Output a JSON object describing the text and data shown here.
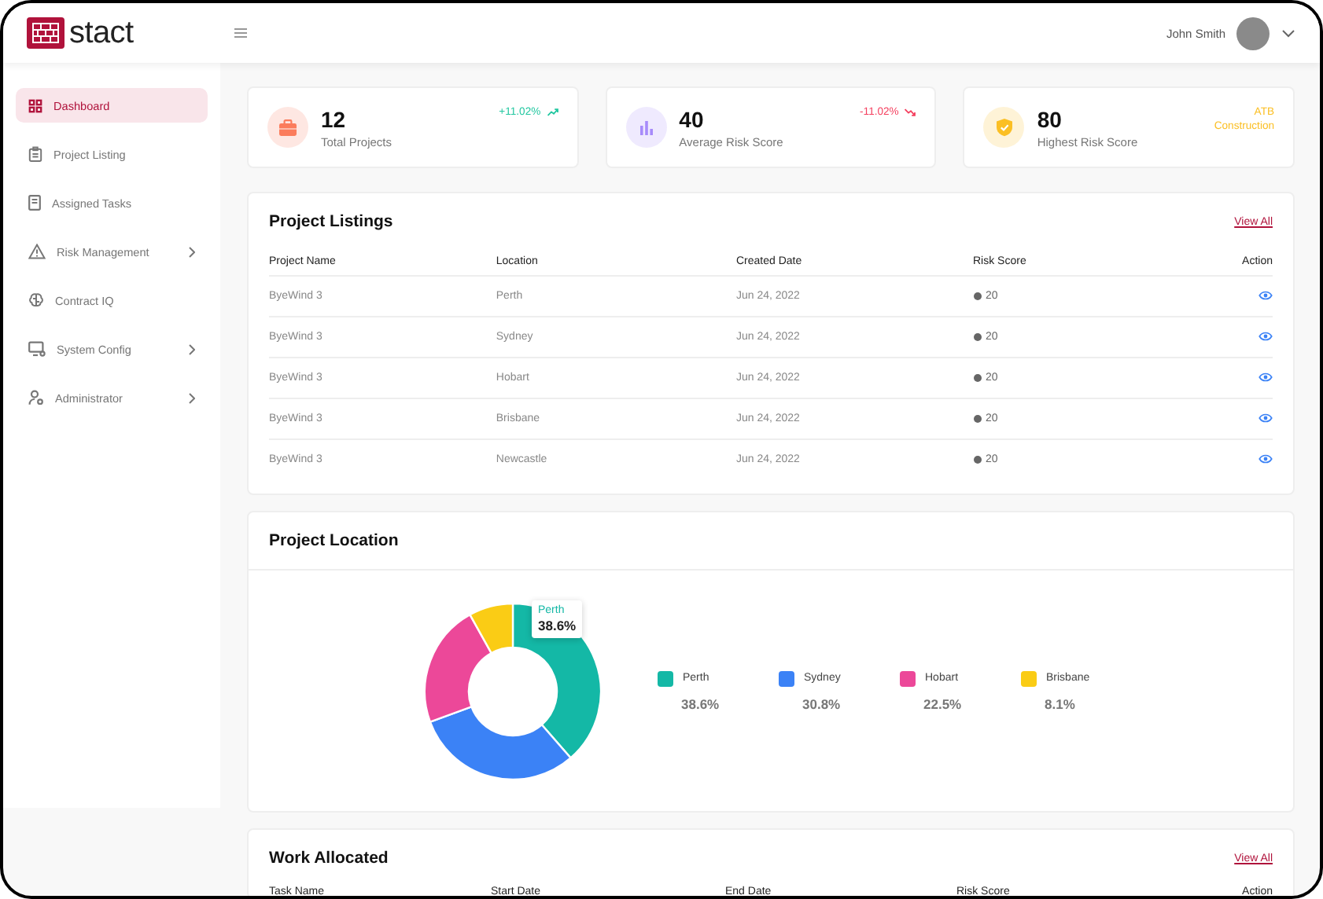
{
  "header": {
    "brand": "stact",
    "user_name": "John Smith"
  },
  "sidebar": {
    "items": [
      {
        "label": "Dashboard",
        "selected": true,
        "expandable": false
      },
      {
        "label": "Project Listing",
        "selected": false,
        "expandable": false
      },
      {
        "label": "Assigned Tasks",
        "selected": false,
        "expandable": false
      },
      {
        "label": "Risk Management",
        "selected": false,
        "expandable": true
      },
      {
        "label": "Contract IQ",
        "selected": false,
        "expandable": false
      },
      {
        "label": "System Config",
        "selected": false,
        "expandable": true
      },
      {
        "label": "Administrator",
        "selected": false,
        "expandable": true
      }
    ]
  },
  "stats": [
    {
      "value": "12",
      "label": "Total Projects",
      "color": "#fb7c5c",
      "trend": "+11.02%",
      "kind": "up"
    },
    {
      "value": "40",
      "label": "Average Risk Score",
      "color": "#a78bfa",
      "trend": "-11.02%",
      "kind": "down"
    },
    {
      "value": "80",
      "label": "Highest Risk Score",
      "color": "#fbbf24",
      "trend": "ATB Construction",
      "kind": "note"
    }
  ],
  "project_listings": {
    "title": "Project Listings",
    "link": "View All",
    "columns": [
      "Project Name",
      "Location",
      "Created Date",
      "Risk Score",
      "Action"
    ],
    "rows": [
      {
        "name": "ByeWind 3",
        "location": "Perth",
        "created": "Jun 24, 2022",
        "risk": "20"
      },
      {
        "name": "ByeWind 3",
        "location": "Sydney",
        "created": "Jun 24, 2022",
        "risk": "20"
      },
      {
        "name": "ByeWind 3",
        "location": "Hobart",
        "created": "Jun 24, 2022",
        "risk": "20"
      },
      {
        "name": "ByeWind 3",
        "location": "Brisbane",
        "created": "Jun 24, 2022",
        "risk": "20"
      },
      {
        "name": "ByeWind 3",
        "location": "Newcastle",
        "created": "Jun 24, 2022",
        "risk": "20"
      }
    ]
  },
  "project_location": {
    "title": "Project Location",
    "chart_data": {
      "type": "donut",
      "categories": [
        "Perth",
        "Sydney",
        "Hobart",
        "Brisbane"
      ],
      "values": [
        38.6,
        30.8,
        22.5,
        8.1
      ]
    },
    "tooltip": {
      "label": "Perth",
      "value": "38.6%"
    },
    "legend": [
      {
        "value": "38.6%",
        "color": "#14b8a6"
      },
      {
        "value": "30.8%",
        "color": "#3b82f6"
      },
      {
        "value": "22.5%",
        "color": "#ec4899"
      },
      {
        "value": "8.1%",
        "color": "#facc15"
      }
    ]
  },
  "work_allocated": {
    "title": "Work Allocated",
    "link": "View All",
    "columns": [
      "Task Name",
      "Start Date",
      "End Date",
      "Risk Score",
      "Action"
    ]
  }
}
